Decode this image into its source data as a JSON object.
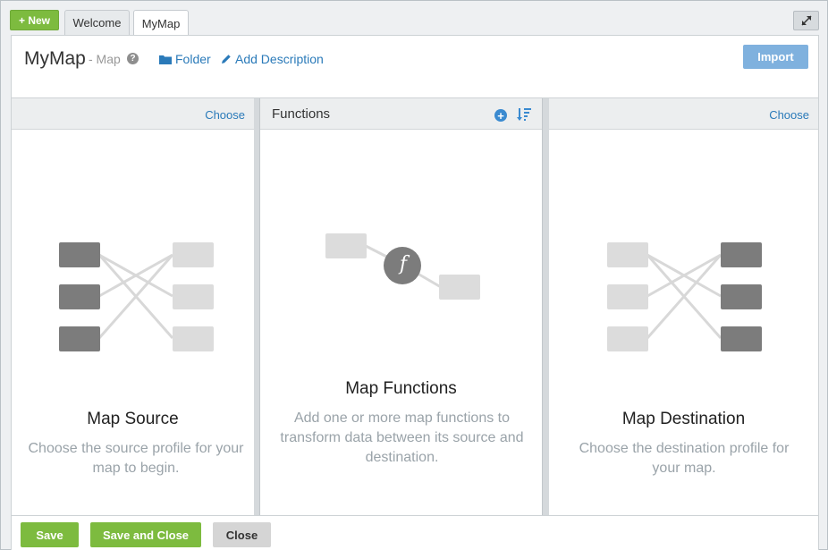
{
  "tabs": {
    "new_label": "+ New",
    "items": [
      {
        "label": "Welcome"
      },
      {
        "label": "MyMap"
      }
    ]
  },
  "header": {
    "title": "MyMap",
    "subtitle": "- Map",
    "help_glyph": "?",
    "folder_label": "Folder",
    "description_label": "Add Description",
    "import_label": "Import"
  },
  "columns": {
    "source": {
      "choose_label": "Choose",
      "title": "Map Source",
      "description": "Choose the source profile for your map to begin."
    },
    "functions": {
      "header": "Functions",
      "add_glyph": "+",
      "function_glyph": "f",
      "title": "Map Functions",
      "description": "Add one or more map functions to transform data between its source and destination."
    },
    "destination": {
      "choose_label": "Choose",
      "title": "Map Destination",
      "description": "Choose the destination profile for your map."
    }
  },
  "footer": {
    "save_label": "Save",
    "save_close_label": "Save and Close",
    "close_label": "Close"
  },
  "colors": {
    "green": "#7dbb3f",
    "blue_link": "#2a7ab9",
    "import_blue": "#7fb1de"
  },
  "icons": [
    "expand-icon",
    "help-icon",
    "folder-icon",
    "pencil-icon",
    "add-circle-icon",
    "sort-icon"
  ]
}
